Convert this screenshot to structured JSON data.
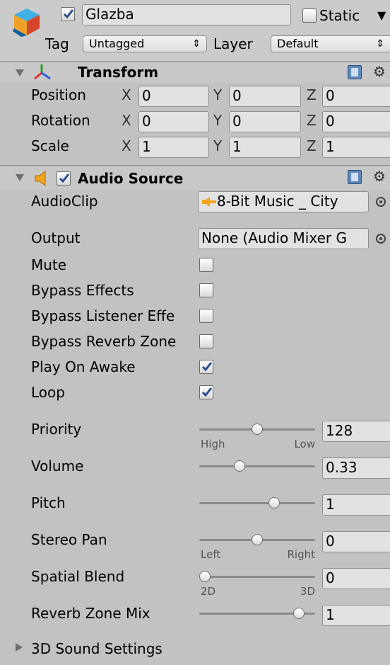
{
  "header": {
    "name": "Glazba",
    "active": true,
    "static_label": "Static",
    "static_checked": false,
    "tag_label": "Tag",
    "tag_value": "Untagged",
    "layer_label": "Layer",
    "layer_value": "Default"
  },
  "transform": {
    "title": "Transform",
    "rows": [
      {
        "label": "Position",
        "x": "0",
        "y": "0",
        "z": "0"
      },
      {
        "label": "Rotation",
        "x": "0",
        "y": "0",
        "z": "0"
      },
      {
        "label": "Scale",
        "x": "1",
        "y": "1",
        "z": "1"
      }
    ],
    "axis": {
      "x": "X",
      "y": "Y",
      "z": "Z"
    }
  },
  "audio": {
    "title": "Audio Source",
    "enabled": true,
    "audioclip_label": "AudioClip",
    "audioclip_value": "8-Bit Music _ City",
    "output_label": "Output",
    "output_value": "None (Audio Mixer G",
    "toggles": [
      {
        "label": "Mute",
        "checked": false
      },
      {
        "label": "Bypass Effects",
        "checked": false
      },
      {
        "label": "Bypass Listener Effe",
        "checked": false
      },
      {
        "label": "Bypass Reverb Zone",
        "checked": false
      },
      {
        "label": "Play On Awake",
        "checked": true
      },
      {
        "label": "Loop",
        "checked": true
      }
    ],
    "sliders": [
      {
        "label": "Priority",
        "value": "128",
        "fraction": 0.5,
        "min_label": "High",
        "max_label": "Low"
      },
      {
        "label": "Volume",
        "value": "0.33",
        "fraction": 0.33,
        "min_label": "",
        "max_label": ""
      },
      {
        "label": "Pitch",
        "value": "1",
        "fraction": 0.66,
        "min_label": "",
        "max_label": ""
      },
      {
        "label": "Stereo Pan",
        "value": "0",
        "fraction": 0.5,
        "min_label": "Left",
        "max_label": "Right"
      },
      {
        "label": "Spatial Blend",
        "value": "0",
        "fraction": 0.0,
        "min_label": "2D",
        "max_label": "3D"
      },
      {
        "label": "Reverb Zone Mix",
        "value": "1",
        "fraction": 0.9,
        "min_label": "",
        "max_label": ""
      }
    ],
    "sound3d_label": "3D Sound Settings"
  }
}
